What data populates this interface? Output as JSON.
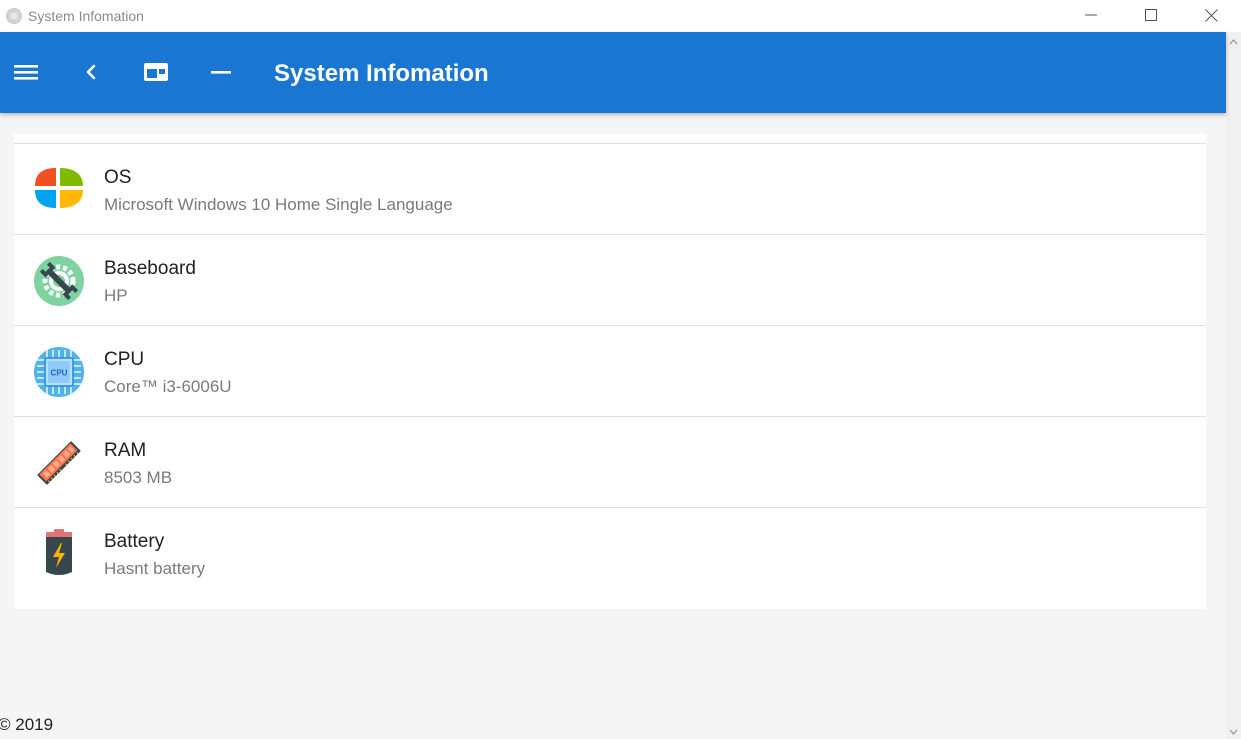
{
  "window": {
    "title": "System Infomation"
  },
  "appbar": {
    "title": "System Infomation",
    "color": "#1976d2",
    "buttons": [
      {
        "name": "menu-icon"
      },
      {
        "name": "back-icon"
      },
      {
        "name": "window-icon"
      },
      {
        "name": "minimize-icon"
      }
    ]
  },
  "items": [
    {
      "label": "OS",
      "value": "Microsoft Windows 10 Home Single Language",
      "icon": "windows-logo-icon"
    },
    {
      "label": "Baseboard",
      "value": "HP",
      "icon": "wrench-gear-icon"
    },
    {
      "label": "CPU",
      "value": "Core™ i3-6006U",
      "icon": "cpu-chip-icon",
      "icon_text": "CPU"
    },
    {
      "label": "RAM",
      "value": "8503 MB",
      "icon": "ram-module-icon"
    },
    {
      "label": "Battery",
      "value": "Hasnt battery",
      "icon": "battery-icon"
    }
  ],
  "footer": {
    "copyright": "© 2019"
  }
}
